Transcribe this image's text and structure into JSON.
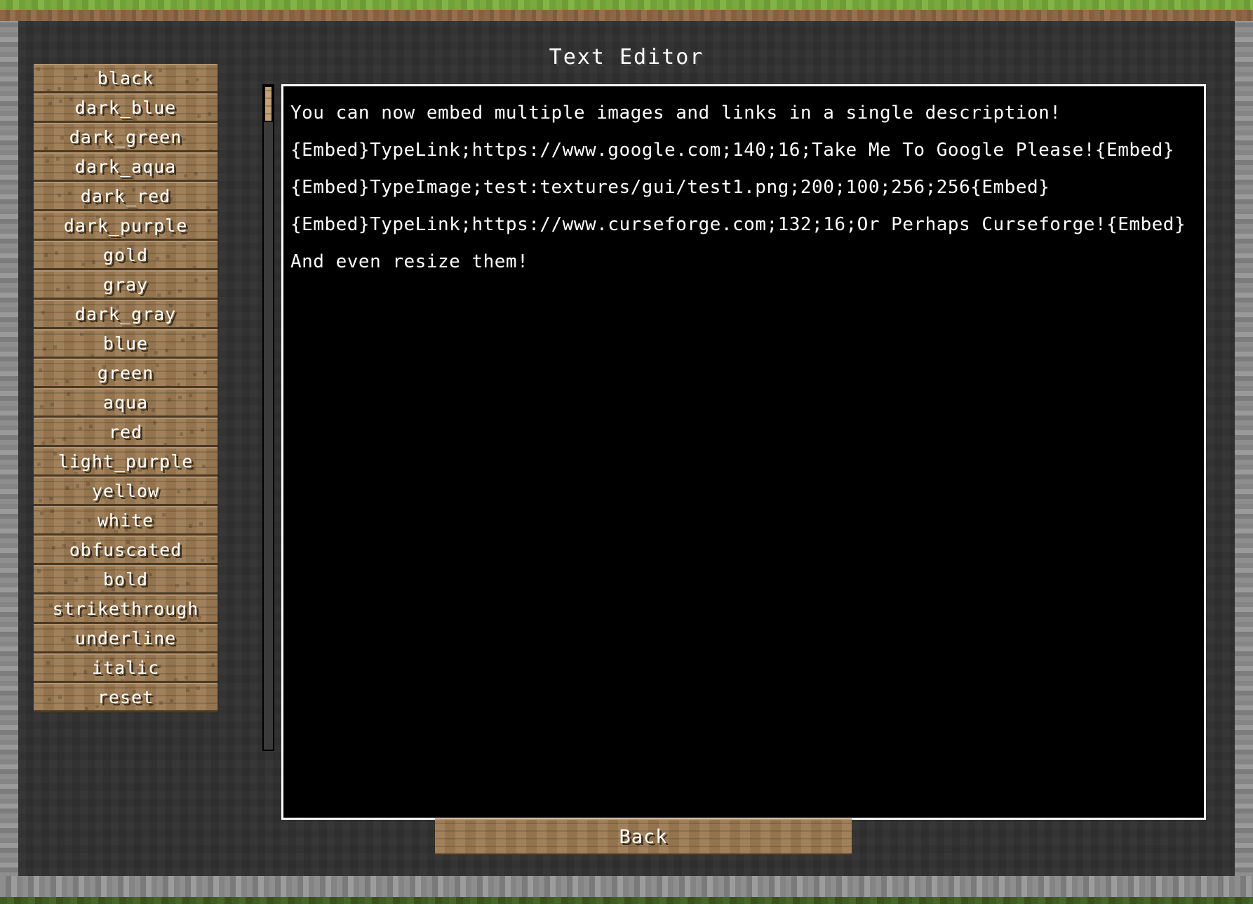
{
  "window": {
    "title": "Text Editor"
  },
  "sidebar": {
    "items": [
      {
        "label": "black"
      },
      {
        "label": "dark_blue"
      },
      {
        "label": "dark_green"
      },
      {
        "label": "dark_aqua"
      },
      {
        "label": "dark_red"
      },
      {
        "label": "dark_purple"
      },
      {
        "label": "gold"
      },
      {
        "label": "gray"
      },
      {
        "label": "dark_gray"
      },
      {
        "label": "blue"
      },
      {
        "label": "green"
      },
      {
        "label": "aqua"
      },
      {
        "label": "red"
      },
      {
        "label": "light_purple"
      },
      {
        "label": "yellow"
      },
      {
        "label": "white"
      },
      {
        "label": "obfuscated"
      },
      {
        "label": "bold"
      },
      {
        "label": "strikethrough"
      },
      {
        "label": "underline"
      },
      {
        "label": "italic"
      },
      {
        "label": "reset"
      }
    ],
    "scrollbar": {
      "name": "vertical-scrollbar",
      "thumb_position_percent": 0
    }
  },
  "editor": {
    "lines": [
      "You can now embed multiple images and links in a single description!",
      "{Embed}TypeLink;https://www.google.com;140;16;Take Me To Google Please!{Embed}",
      "{Embed}TypeImage;test:textures/gui/test1.png;200;100;256;256{Embed}",
      "{Embed}TypeLink;https://www.curseforge.com;132;16;Or Perhaps Curseforge!{Embed}",
      "And even resize them!"
    ]
  },
  "footer": {
    "back_label": "Back"
  },
  "colors": {
    "panel_background": "#303030",
    "plank": "#9b7a52",
    "plank_highlight": "#b49470",
    "plank_shadow": "#4a3a24",
    "editor_background": "#000000",
    "editor_border": "#ffffff",
    "text": "#ffffff",
    "grass": "#79a93f",
    "dirt": "#8d6748",
    "stone": "#8e8e8e"
  }
}
